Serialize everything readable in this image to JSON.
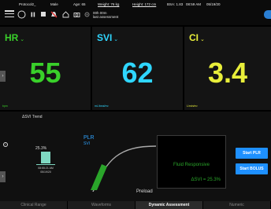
{
  "header": {
    "patient_id": "Protocol2_",
    "sex": "Male",
    "age": "Age: 65",
    "weight": "Weight: 76 kg",
    "height": "Height: 172 cm",
    "bsa": "BSA: 1.83",
    "time": "08:59 AM",
    "date": "05/19/20",
    "timer_value": "00h 00m",
    "timer_label": "last assessment"
  },
  "tiles": [
    {
      "label": "HR",
      "value": "55",
      "unit": "bpm",
      "color": "#39d02a"
    },
    {
      "label": "SVI",
      "value": "62",
      "unit": "mL/beat/m²",
      "color": "#2fd6ff"
    },
    {
      "label": "CI",
      "value": "3.4",
      "unit": "L/min/m²",
      "color": "#e8ee3a"
    }
  ],
  "trend": {
    "title": "ΔSVI Trend",
    "percent": "25.3%",
    "time": "08:55:21 AM",
    "date": "05/19/20"
  },
  "plr": {
    "title": "PLR",
    "sub": "SVI",
    "xlabel": "Preload",
    "fluid_status": "Fluid Responsive",
    "delta_svi": "ΔSVI = 25.3%"
  },
  "buttons": {
    "start_plr": "Start PLR",
    "start_bolus": "Start BOLUS"
  },
  "tabs": [
    {
      "label": "Clinical Range",
      "active": false
    },
    {
      "label": "Waveforms",
      "active": false
    },
    {
      "label": "Dynamic Assessment",
      "active": true
    },
    {
      "label": "Numeric",
      "active": false
    }
  ]
}
